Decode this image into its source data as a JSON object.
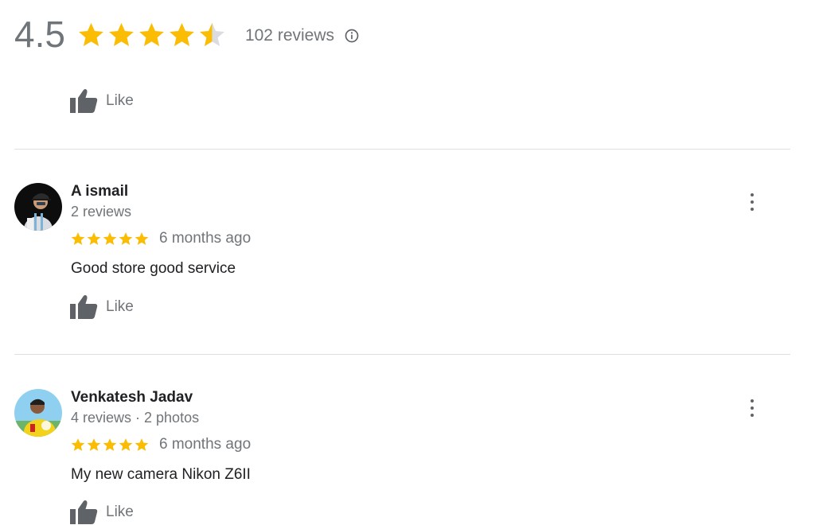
{
  "summary": {
    "rating": "4.5",
    "stars_value": 4.5,
    "stars_max": 5,
    "reviews_label": "102 reviews",
    "info_icon": "info-icon"
  },
  "top_like": {
    "label": "Like",
    "icon": "thumbs-up-icon"
  },
  "reviews": [
    {
      "name": "A ismail",
      "meta": "2 reviews",
      "rating": 5,
      "time": "6 months ago",
      "text": "Good store good service",
      "like_label": "Like",
      "avatar_icon": "avatar-cap-person"
    },
    {
      "name": "Venkatesh Jadav",
      "meta": "4 reviews · 2 photos",
      "rating": 5,
      "time": "6 months ago",
      "text": "My new camera Nikon Z6II",
      "like_label": "Like",
      "avatar_icon": "avatar-yellow-shirt-person"
    }
  ],
  "colors": {
    "star": "#fbbc04",
    "star_empty": "#dadce0",
    "muted_text": "#70757a",
    "icon_gray": "#5f6368"
  }
}
